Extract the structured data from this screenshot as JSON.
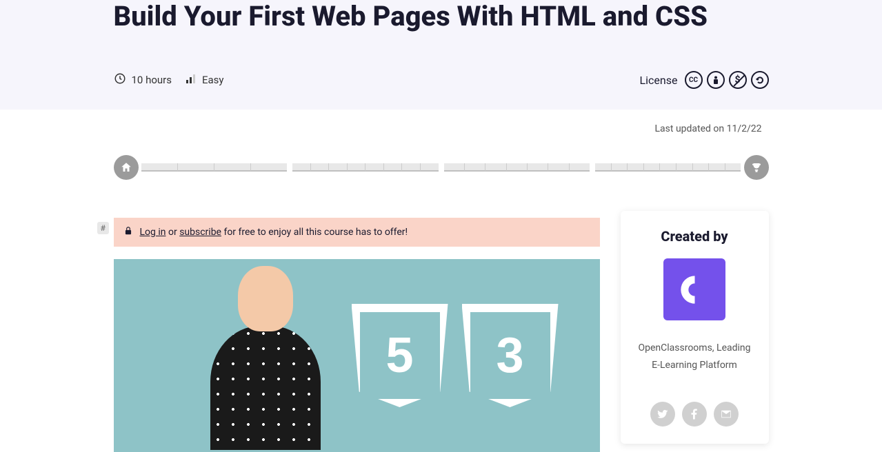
{
  "hero": {
    "title": "Build Your First Web Pages With HTML and CSS",
    "duration": "10 hours",
    "difficulty": "Easy",
    "license_label": "License"
  },
  "updated": "Last updated on 11/2/22",
  "alert": {
    "login_text": "Log in",
    "or_text": " or ",
    "subscribe_text": "subscribe",
    "tail_text": " for free to enjoy all this course has to offer!"
  },
  "hash": "#",
  "shields": {
    "html": "5",
    "css": "3"
  },
  "sidebar": {
    "heading": "Created by",
    "creator": "OpenClassrooms, Leading E-Learning Platform"
  },
  "progress": {
    "groups": [
      4,
      8,
      7,
      9
    ]
  }
}
